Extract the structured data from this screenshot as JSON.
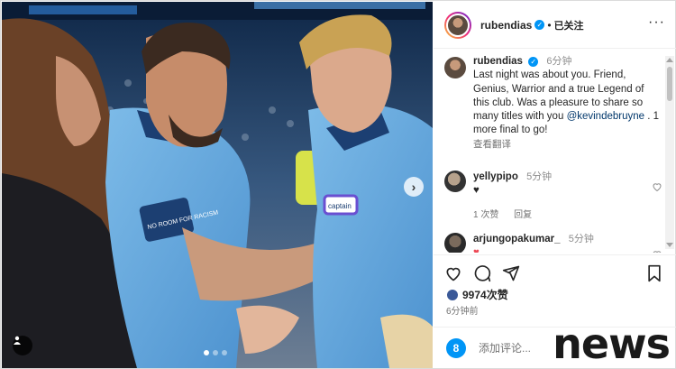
{
  "post": {
    "username": "rubendias",
    "follow_state": "已关注",
    "separator": "•",
    "caption_time": "6分钟",
    "caption_text": "Last night was about you. Friend, Genius, Warrior and a true Legend of this club. Was a pleasure to share so many titles with you",
    "caption_mention": "@kevindebruyne",
    "caption_tail": ". 1 more final to go!",
    "translate_label": "查看翻译",
    "likes_text": "9974次赞",
    "posted_time": "6分钟前",
    "add_comment_placeholder": "添加评论..."
  },
  "comments": [
    {
      "user": "yellypipo",
      "time": "5分钟",
      "text": "♥",
      "likes": "1 次赞",
      "reply": "回复"
    },
    {
      "user": "arjungopakumar_",
      "time": "5分钟",
      "text": "♥"
    }
  ],
  "photo": {
    "jersey_text": "NO ROOM FOR RACISM",
    "armband_text": "captain"
  },
  "watermark": "news",
  "colors": {
    "accent": "#0095f6",
    "sky_blue_kit": "#6caee0",
    "text": "#262626",
    "muted": "#737373"
  },
  "icons": [
    "more-options-icon",
    "heart-icon",
    "comment-icon",
    "share-icon",
    "bookmark-icon",
    "verified-icon",
    "user-tag-icon",
    "next-arrow-icon",
    "emoji-icon"
  ]
}
